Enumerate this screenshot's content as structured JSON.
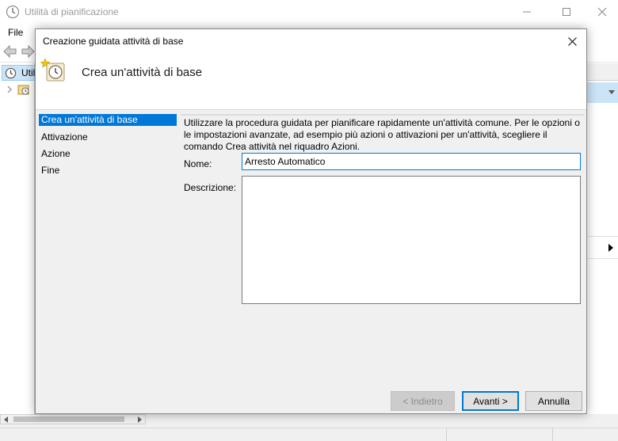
{
  "main_window": {
    "title": "Utilità di pianificazione",
    "menu": {
      "file": "File"
    },
    "tree": {
      "root_label": "Utili"
    }
  },
  "dialog": {
    "title": "Creazione guidata attività di base",
    "header_title": "Crea un'attività di base",
    "steps": [
      {
        "label": "Crea un'attività di base",
        "active": true
      },
      {
        "label": "Attivazione"
      },
      {
        "label": "Azione"
      },
      {
        "label": "Fine"
      }
    ],
    "intro_text": "Utilizzare la procedura guidata per pianificare rapidamente un'attività comune. Per le opzioni o le impostazioni avanzate, ad esempio più azioni o attivazioni per un'attività, scegliere il comando Crea attività nel riquadro Azioni.",
    "name_label": "Nome:",
    "name_value": "Arresto Automatico",
    "description_label": "Descrizione:",
    "description_value": "",
    "buttons": {
      "back": "< Indietro",
      "next": "Avanti >",
      "cancel": "Annulla"
    }
  }
}
